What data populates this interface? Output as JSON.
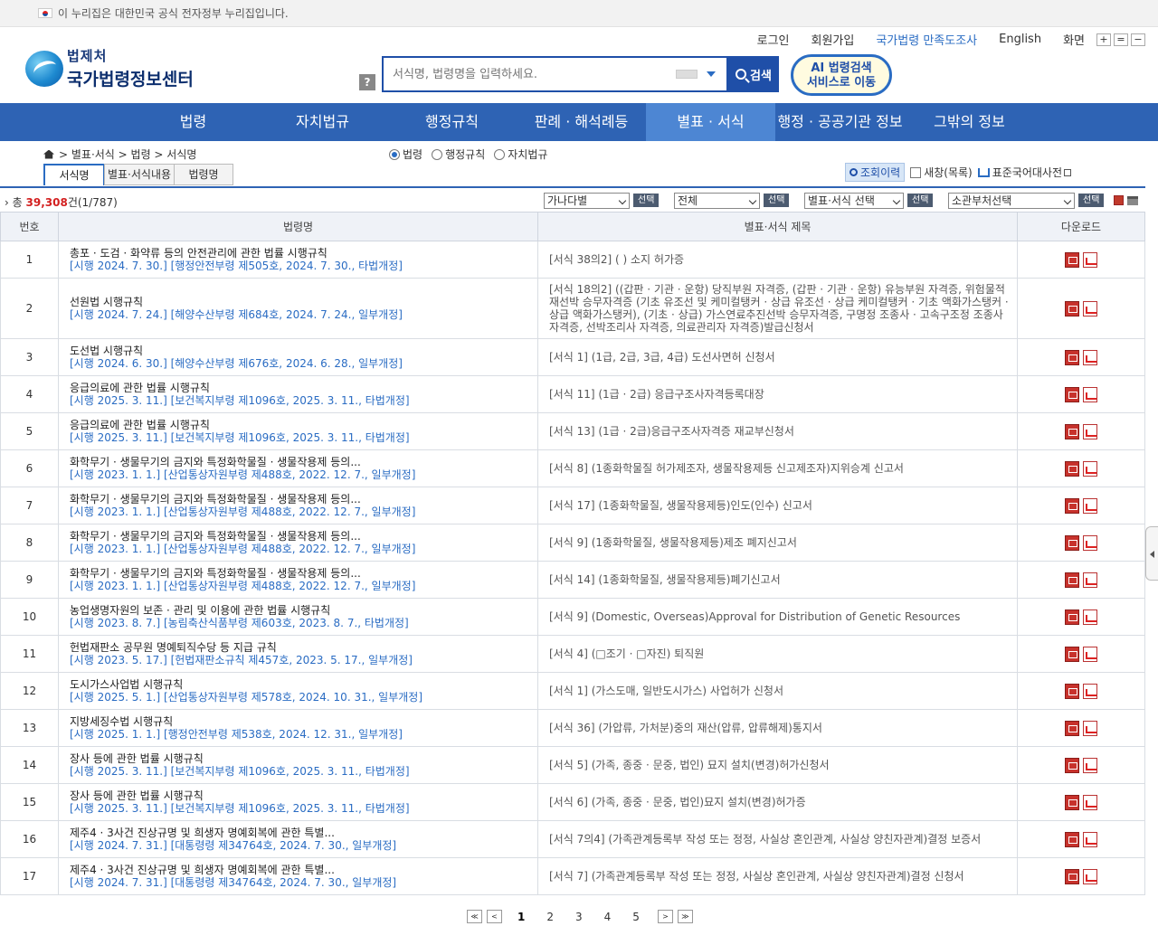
{
  "gov_banner": "이 누리집은 대한민국 공식 전자정부 누리집입니다.",
  "logo": {
    "small": "법제처",
    "big": "국가법령정보센터"
  },
  "util": {
    "login": "로그인",
    "signup": "회원가입",
    "survey": "국가법령 만족도조사",
    "english": "English",
    "screen": "화면",
    "zoom": [
      "+",
      "=",
      "−"
    ]
  },
  "search": {
    "placeholder": "서식명, 법령명을 입력하세요.",
    "button": "검색",
    "help": "?"
  },
  "ai_button": {
    "line1": "AI 법령검색",
    "line2": "서비스로 이동"
  },
  "nav": [
    "법령",
    "자치법규",
    "행정규칙",
    "판례 · 해석례등",
    "별표 · 서식",
    "행정 · 공공기관 정보",
    "그밖의 정보"
  ],
  "breadcrumb": "> 별표·서식 > 법령 > 서식명",
  "radios": [
    "법령",
    "행정규칙",
    "자치법규"
  ],
  "subtabs": [
    "서식명",
    "별표·서식내용",
    "법령명"
  ],
  "tools": {
    "history": "조회이력",
    "newwin": "새창(목록)",
    "dictionary": "표준국어대사전"
  },
  "toolbar": {
    "total_prefix": "총",
    "total_count": "39,308",
    "total_suffix": "건(1/787)",
    "sort": "가나다별",
    "btn": "선택",
    "scope": "전체",
    "type": "별표·서식 선택",
    "ministry": "소관부처선택"
  },
  "table": {
    "headers": [
      "번호",
      "법령명",
      "별표·서식 제목",
      "다운로드"
    ],
    "rows": [
      {
        "n": "1",
        "t": "총포 · 도검 · 화약류 등의 안전관리에 관한 법률 시행규칙",
        "d": "[시행 2024. 7. 30.] [행정안전부령 제505호, 2024. 7. 30., 타법개정]",
        "f": "[서식 38의2] ( ) 소지 허가증"
      },
      {
        "n": "2",
        "t": "선원법 시행규칙",
        "d": "[시행 2024. 7. 24.] [해양수산부령 제684호, 2024. 7. 24., 일부개정]",
        "f": "[서식 18의2] ((갑판 · 기관 · 운항) 당직부원 자격증, (갑판 · 기관 · 운항) 유능부원 자격증, 위험물적재선박 승무자격증 (기초 유조선 및 케미컬탱커 · 상급 유조선 · 상급 케미컬탱커 · 기초 액화가스탱커 · 상급 액화가스탱커), (기초 · 상급) 가스연료추진선박 승무자격증, 구명정 조종사 · 고속구조정 조종사 자격증, 선박조리사 자격증, 의료관리자 자격증)발급신청서"
      },
      {
        "n": "3",
        "t": "도선법 시행규칙",
        "d": "[시행 2024. 6. 30.] [해양수산부령 제676호, 2024. 6. 28., 일부개정]",
        "f": "[서식 1] (1급, 2급, 3급, 4급) 도선사면허 신청서"
      },
      {
        "n": "4",
        "t": "응급의료에 관한 법률 시행규칙",
        "d": "[시행 2025. 3. 11.] [보건복지부령 제1096호, 2025. 3. 11., 타법개정]",
        "f": "[서식 11] (1급 · 2급) 응급구조사자격등록대장"
      },
      {
        "n": "5",
        "t": "응급의료에 관한 법률 시행규칙",
        "d": "[시행 2025. 3. 11.] [보건복지부령 제1096호, 2025. 3. 11., 타법개정]",
        "f": "[서식 13] (1급 · 2급)응급구조사자격증 재교부신청서"
      },
      {
        "n": "6",
        "t": "화학무기 · 생물무기의 금지와 특정화학물질 · 생물작용제 등의...",
        "d": "[시행 2023. 1. 1.] [산업통상자원부령 제488호, 2022. 12. 7., 일부개정]",
        "f": "[서식 8] (1종화학물질 허가제조자, 생물작용제등 신고제조자)지위승계 신고서"
      },
      {
        "n": "7",
        "t": "화학무기 · 생물무기의 금지와 특정화학물질 · 생물작용제 등의...",
        "d": "[시행 2023. 1. 1.] [산업통상자원부령 제488호, 2022. 12. 7., 일부개정]",
        "f": "[서식 17] (1종화학물질, 생물작용제등)인도(인수) 신고서"
      },
      {
        "n": "8",
        "t": "화학무기 · 생물무기의 금지와 특정화학물질 · 생물작용제 등의...",
        "d": "[시행 2023. 1. 1.] [산업통상자원부령 제488호, 2022. 12. 7., 일부개정]",
        "f": "[서식 9] (1종화학물질, 생물작용제등)제조 폐지신고서"
      },
      {
        "n": "9",
        "t": "화학무기 · 생물무기의 금지와 특정화학물질 · 생물작용제 등의...",
        "d": "[시행 2023. 1. 1.] [산업통상자원부령 제488호, 2022. 12. 7., 일부개정]",
        "f": "[서식 14] (1종화학물질, 생물작용제등)폐기신고서"
      },
      {
        "n": "10",
        "t": "농업생명자원의 보존 · 관리 및 이용에 관한 법률 시행규칙",
        "d": "[시행 2023. 8. 7.] [농림축산식품부령 제603호, 2023. 8. 7., 타법개정]",
        "f": "[서식 9] (Domestic, Overseas)Approval for Distribution of Genetic Resources"
      },
      {
        "n": "11",
        "t": "헌법재판소 공무원 명예퇴직수당 등 지급 규칙",
        "d": "[시행 2023. 5. 17.] [헌법재판소규칙 제457호, 2023. 5. 17., 일부개정]",
        "f": "[서식 4] (□조기 · □자진) 퇴직원"
      },
      {
        "n": "12",
        "t": "도시가스사업법 시행규칙",
        "d": "[시행 2025. 5. 1.] [산업통상자원부령 제578호, 2024. 10. 31., 일부개정]",
        "f": "[서식 1] (가스도매, 일반도시가스) 사업허가 신청서"
      },
      {
        "n": "13",
        "t": "지방세징수법 시행규칙",
        "d": "[시행 2025. 1. 1.] [행정안전부령 제538호, 2024. 12. 31., 일부개정]",
        "f": "[서식 36] (가압류, 가처분)중의 재산(압류, 압류해제)통지서"
      },
      {
        "n": "14",
        "t": "장사 등에 관한 법률 시행규칙",
        "d": "[시행 2025. 3. 11.] [보건복지부령 제1096호, 2025. 3. 11., 타법개정]",
        "f": "[서식 5] (가족, 종중 · 문중, 법인) 묘지 설치(변경)허가신청서"
      },
      {
        "n": "15",
        "t": "장사 등에 관한 법률 시행규칙",
        "d": "[시행 2025. 3. 11.] [보건복지부령 제1096호, 2025. 3. 11., 타법개정]",
        "f": "[서식 6] (가족, 종중 · 문중, 법인)묘지 설치(변경)허가증"
      },
      {
        "n": "16",
        "t": "제주4 · 3사건 진상규명 및 희생자 명예회복에 관한 특별...",
        "d": "[시행 2024. 7. 31.] [대통령령 제34764호, 2024. 7. 30., 일부개정]",
        "f": "[서식 7의4] (가족관계등록부 작성 또는 정정, 사실상 혼인관계, 사실상 양친자관계)결정 보증서"
      },
      {
        "n": "17",
        "t": "제주4 · 3사건 진상규명 및 희생자 명예회복에 관한 특별...",
        "d": "[시행 2024. 7. 31.] [대통령령 제34764호, 2024. 7. 30., 일부개정]",
        "f": "[서식 7] (가족관계등록부 작성 또는 정정, 사실상 혼인관계, 사실상 양친자관계)결정 신청서"
      }
    ]
  },
  "pager": {
    "first": "≪",
    "prev": "<",
    "pages": [
      "1",
      "2",
      "3",
      "4",
      "5"
    ],
    "current": "1",
    "next": ">",
    "last": "≫"
  }
}
